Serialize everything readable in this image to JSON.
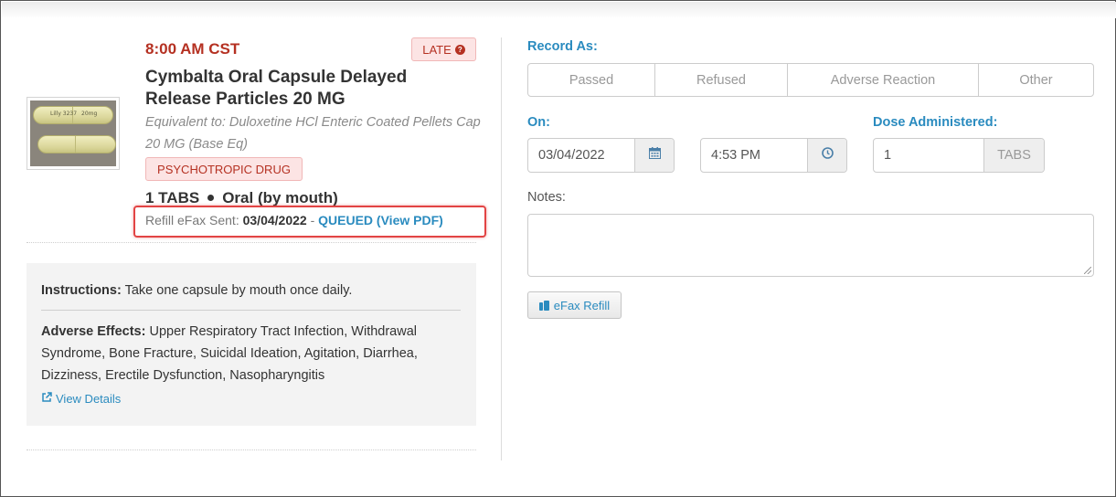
{
  "medication": {
    "time": "8:00 AM CST",
    "late_label": "LATE",
    "name": "Cymbalta Oral Capsule Delayed Release Particles 20 MG",
    "equivalent": "Equivalent to: Duloxetine HCl Enteric Coated Pellets Cap 20 MG (Base Eq)",
    "category_badge": "PSYCHOTROPIC DRUG",
    "dose_amount": "1 TABS",
    "route": "Oral (by mouth)",
    "image_imprint": "Lilly 3237",
    "image_strength": "20mg"
  },
  "refill": {
    "label": "Refill eFax Sent:",
    "date": "03/04/2022",
    "separator": "-",
    "status": "QUEUED (View PDF)"
  },
  "instructions": {
    "label": "Instructions:",
    "text": "Take one capsule by mouth once daily.",
    "adverse_label": "Adverse Effects:",
    "adverse_text": "Upper Respiratory Tract Infection, Withdrawal Syndrome, Bone Fracture, Suicidal Ideation, Agitation, Diarrhea, Dizziness, Erectile Dysfunction, Nasopharyngitis",
    "view_details": "View Details"
  },
  "record": {
    "label": "Record As:",
    "options": [
      "Passed",
      "Refused",
      "Adverse Reaction",
      "Other"
    ]
  },
  "on": {
    "label": "On:",
    "date": "03/04/2022",
    "time": "4:53 PM"
  },
  "dose_administered": {
    "label": "Dose Administered:",
    "value": "1",
    "unit": "TABS"
  },
  "notes": {
    "label": "Notes:",
    "value": ""
  },
  "efax_button": "eFax Refill",
  "colors": {
    "accent": "#2a8bbf",
    "alert": "#b53122",
    "highlight_box": "#e24444"
  }
}
